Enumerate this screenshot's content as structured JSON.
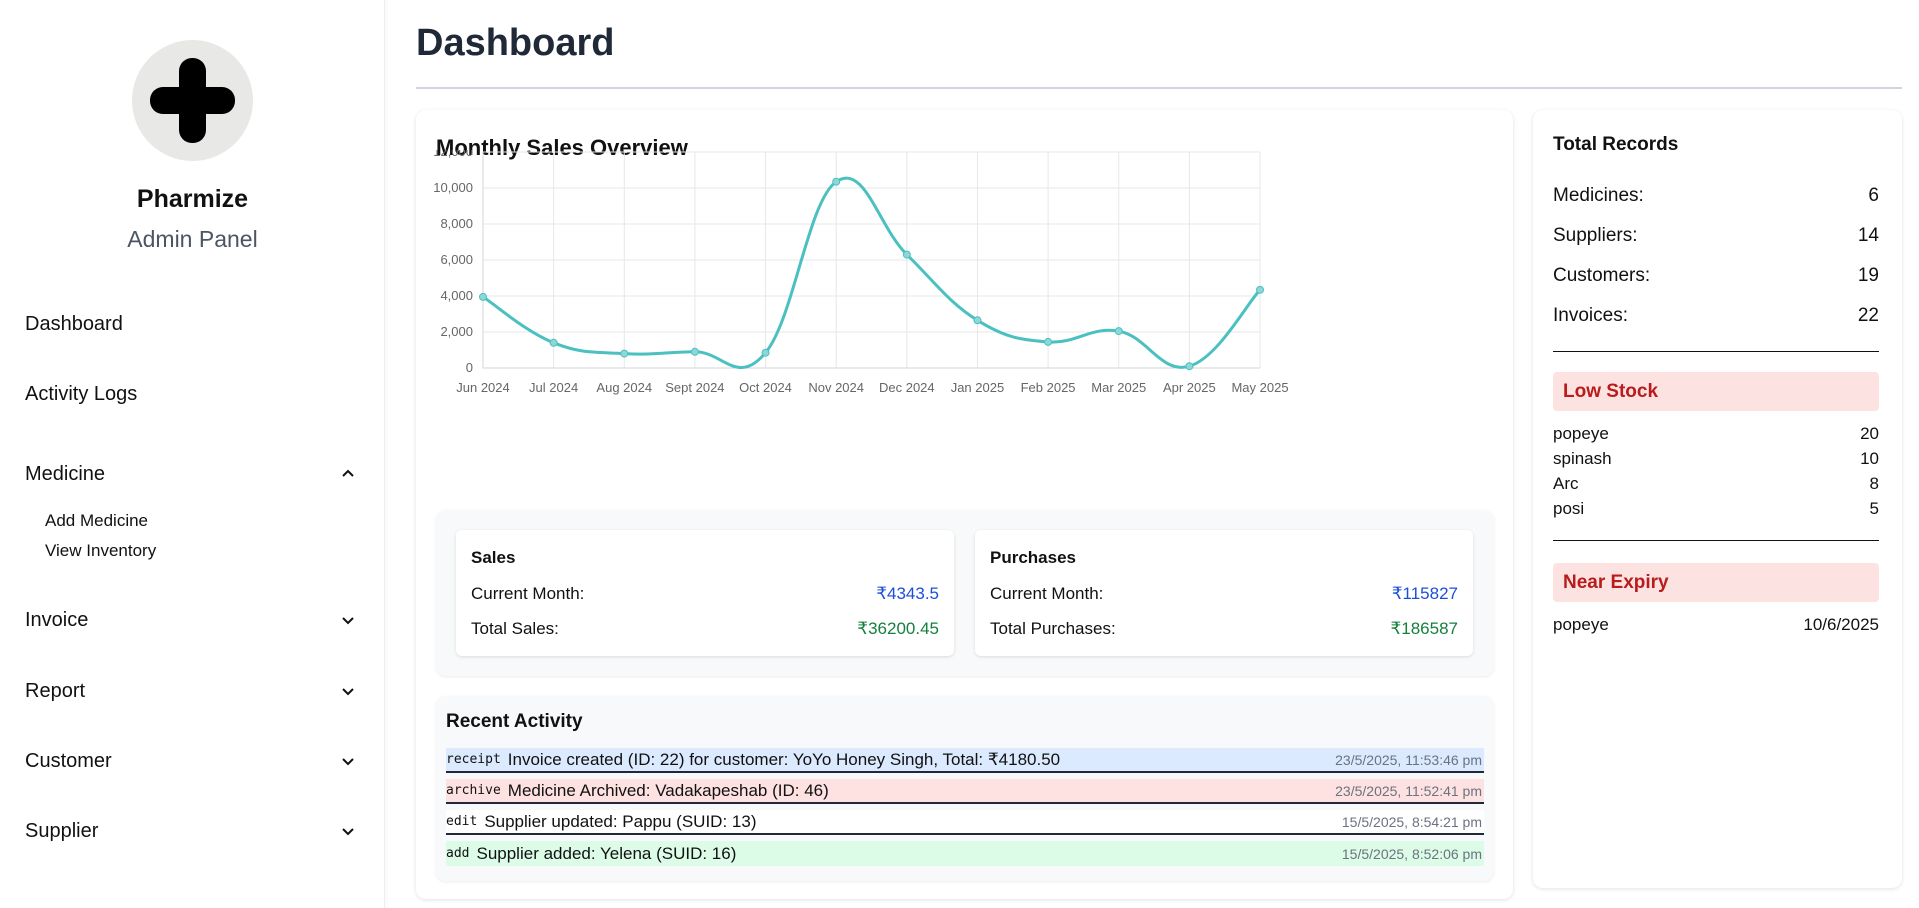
{
  "brand": {
    "name": "Pharmize",
    "subtitle": "Admin Panel"
  },
  "sidebar": {
    "items": [
      {
        "label": "Dashboard",
        "expandable": false
      },
      {
        "label": "Activity Logs",
        "expandable": false
      },
      {
        "label": "Medicine",
        "expandable": true,
        "expanded": true,
        "children": [
          "Add Medicine",
          "View Inventory"
        ]
      },
      {
        "label": "Invoice",
        "expandable": true,
        "expanded": false
      },
      {
        "label": "Report",
        "expandable": true,
        "expanded": false
      },
      {
        "label": "Customer",
        "expandable": true,
        "expanded": false
      },
      {
        "label": "Supplier",
        "expandable": true,
        "expanded": false
      }
    ]
  },
  "page": {
    "title": "Dashboard"
  },
  "chart_section": {
    "title": "Monthly Sales Overview"
  },
  "chart_data": {
    "type": "line",
    "title": "Monthly Sales Overview",
    "categories": [
      "Jun 2024",
      "Jul 2024",
      "Aug 2024",
      "Sept 2024",
      "Oct 2024",
      "Nov 2024",
      "Dec 2024",
      "Jan 2025",
      "Feb 2025",
      "Mar 2025",
      "Apr 2025",
      "May 2025"
    ],
    "values": [
      3950,
      1400,
      800,
      900,
      850,
      10350,
      6300,
      2650,
      1450,
      2050,
      100,
      4343.5
    ],
    "ylim": [
      0,
      12000
    ],
    "yticks": [
      "0",
      "2,000",
      "4,000",
      "6,000",
      "8,000",
      "10,000",
      "12,000"
    ],
    "grid": true,
    "line_color": "#4bc0c0"
  },
  "sales": {
    "heading": "Sales",
    "current_label": "Current Month:",
    "current_value": "₹4343.5",
    "total_label": "Total Sales:",
    "total_value": "₹36200.45"
  },
  "purchases": {
    "heading": "Purchases",
    "current_label": "Current Month:",
    "current_value": "₹115827",
    "total_label": "Total Purchases:",
    "total_value": "₹186587"
  },
  "activity": {
    "title": "Recent Activity",
    "items": [
      {
        "icon": "receipt",
        "text": "Invoice created (ID: 22) for customer: YoYo Honey Singh, Total: ₹4180.50",
        "time": "23/5/2025, 11:53:46 pm",
        "color": "#dbeafe"
      },
      {
        "icon": "archive",
        "text": "Medicine Archived: Vadakapeshab (ID: 46)",
        "time": "23/5/2025, 11:52:41 pm",
        "color": "#fee2e2"
      },
      {
        "icon": "edit",
        "text": "Supplier updated: Pappu (SUID: 13)",
        "time": "15/5/2025, 8:54:21 pm",
        "color": "#ffffff"
      },
      {
        "icon": "add",
        "text": "Supplier added: Yelena (SUID: 16)",
        "time": "15/5/2025, 8:52:06 pm",
        "color": "#dcfce7"
      }
    ]
  },
  "records": {
    "title": "Total Records",
    "items": [
      {
        "label": "Medicines:",
        "value": "6"
      },
      {
        "label": "Suppliers:",
        "value": "14"
      },
      {
        "label": "Customers:",
        "value": "19"
      },
      {
        "label": "Invoices:",
        "value": "22"
      }
    ]
  },
  "low_stock": {
    "title": "Low Stock",
    "items": [
      {
        "name": "popeye",
        "qty": "20"
      },
      {
        "name": "spinash",
        "qty": "10"
      },
      {
        "name": "Arc",
        "qty": "8"
      },
      {
        "name": "posi",
        "qty": "5"
      }
    ]
  },
  "near_expiry": {
    "title": "Near Expiry",
    "items": [
      {
        "name": "popeye",
        "date": "10/6/2025"
      }
    ]
  },
  "colors": {
    "alert_bg": "#fde2e2",
    "alert_text": "#b91c1c",
    "blue_value": "#1d4ed8",
    "green_value": "#15803d"
  }
}
